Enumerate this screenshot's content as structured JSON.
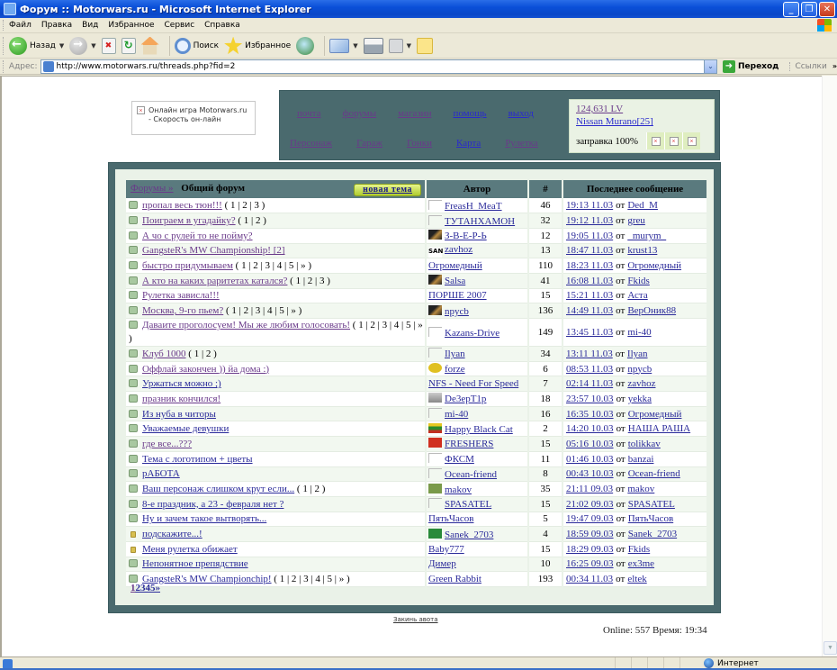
{
  "window": {
    "title": "Форум :: Motorwars.ru - Microsoft Internet Explorer",
    "min": "_",
    "max": "❐",
    "close": "✕"
  },
  "menu": [
    "Файл",
    "Правка",
    "Вид",
    "Избранное",
    "Сервис",
    "Справка"
  ],
  "toolbar": {
    "back": "Назад",
    "search": "Поиск",
    "favorites": "Избранное",
    "dropdown": "▼"
  },
  "address": {
    "label": "Адрес:",
    "url": "http://www.motorwars.ru/threads.php?fid=2",
    "go": "Переход",
    "links": "Ссылки",
    "more": "»",
    "dropdown": "⌄"
  },
  "banner": {
    "broken": "×",
    "text": "Онлайн игра Motorwars.ru - Скорость он-лайн"
  },
  "nav": {
    "row1": [
      {
        "label": "почта",
        "visited": true
      },
      {
        "label": "форумы",
        "visited": true
      },
      {
        "label": "магазин",
        "visited": true
      },
      {
        "label": "помощь",
        "visited": false
      },
      {
        "label": "выход",
        "visited": false
      }
    ],
    "row2": [
      {
        "label": "Персонаж",
        "visited": true
      },
      {
        "label": "Гараж",
        "visited": true
      },
      {
        "label": "Гонки",
        "visited": true
      },
      {
        "label": "Карта",
        "visited": false
      },
      {
        "label": "Рулетка",
        "visited": true
      }
    ]
  },
  "status": {
    "money": "124,631 LV",
    "car": "Nissan Murano[25]",
    "fuel": "заправка 100%",
    "broken": "×"
  },
  "forum": {
    "breadcrumb": "Форумы »",
    "title": "Общий форум",
    "new_topic": "новая тема",
    "columns": {
      "author": "Автор",
      "count": "#",
      "last": "Последнее сообщение"
    },
    "from_word": "от",
    "threads": [
      {
        "title": "пропал весь тюн!!!",
        "visited": true,
        "pages": "( 1 | 2 | 3 )",
        "author": "FreasH_MeaT",
        "avatar": "blank",
        "count": "46",
        "last_time": "19:13 11.03",
        "last_user": "Ded_M"
      },
      {
        "title": "Поиграем в угадайку?",
        "visited": true,
        "pages": "( 1 | 2 )",
        "author": "ТУТАНХАМОН",
        "avatar": "blank",
        "count": "32",
        "last_time": "19:12 11.03",
        "last_user": "greu"
      },
      {
        "title": "А чо с рулей то не пойму?",
        "visited": true,
        "pages": "",
        "author": "З-В-Е-Р-Ь",
        "avatar": "dark",
        "count": "12",
        "last_time": "19:05 11.03",
        "last_user": "_murym_"
      },
      {
        "title": "GangsteR's MW Championship! [2]",
        "visited": true,
        "pages": "",
        "author": "zavhoz",
        "avatar": "san",
        "count": "13",
        "last_time": "18:47 11.03",
        "last_user": "krust13"
      },
      {
        "title": "быстро придумываем",
        "visited": true,
        "pages": "( 1 | 2 | 3 | 4 | 5 | » )",
        "author": "Огромедный",
        "avatar": "none",
        "count": "110",
        "last_time": "18:23 11.03",
        "last_user": "Огромедный"
      },
      {
        "title": "А кто на каких раритетах катался?",
        "visited": true,
        "pages": "( 1 | 2 | 3 )",
        "author": "Salsa",
        "avatar": "dark",
        "count": "41",
        "last_time": "16:08 11.03",
        "last_user": "Fkids"
      },
      {
        "title": "Рулетка зависла!!!",
        "visited": true,
        "pages": "",
        "author": "ПОРШЕ 2007",
        "avatar": "none",
        "count": "15",
        "last_time": "15:21 11.03",
        "last_user": "Аста"
      },
      {
        "title": "Москва, 9-го пьем?",
        "visited": true,
        "pages": "( 1 | 2 | 3 | 4 | 5 | » )",
        "author": "npycb",
        "avatar": "dark",
        "count": "136",
        "last_time": "14:49 11.03",
        "last_user": "ВерОник88"
      },
      {
        "title": "Даваите проголосуем! Мы же любим голосовать!",
        "visited": true,
        "pages": "( 1 | 2 | 3 | 4 | 5 | » )",
        "author": "Kazans-Drive",
        "avatar": "blank",
        "count": "149",
        "last_time": "13:45 11.03",
        "last_user": "mi-40",
        "wrap": true
      },
      {
        "title": "Клуб 1000",
        "visited": true,
        "pages": "( 1 | 2 )",
        "author": "Ilyan",
        "avatar": "blank",
        "count": "34",
        "last_time": "13:11 11.03",
        "last_user": "Ilyan"
      },
      {
        "title": "Оффлай закончен )) йа дома :)",
        "visited": true,
        "pages": "",
        "author": "forze",
        "avatar": "yellow",
        "count": "6",
        "last_time": "08:53 11.03",
        "last_user": "npycb"
      },
      {
        "title": "Уржаться можно ;)",
        "visited": false,
        "pages": "",
        "author": "NFS - Need For Speed",
        "avatar": "none",
        "count": "7",
        "last_time": "02:14 11.03",
        "last_user": "zavhoz"
      },
      {
        "title": "празник кончился!",
        "visited": true,
        "pages": "",
        "author": "De3epT1p",
        "avatar": "tank",
        "count": "18",
        "last_time": "23:57 10.03",
        "last_user": "yekka"
      },
      {
        "title": "Из нуба в читоры",
        "visited": false,
        "pages": "",
        "author": "mi-40",
        "avatar": "blank",
        "count": "16",
        "last_time": "16:35 10.03",
        "last_user": "Огромедный"
      },
      {
        "title": "Уважаемые девушки",
        "visited": false,
        "pages": "",
        "author": "Happy Black Cat",
        "avatar": "flag",
        "count": "2",
        "last_time": "14:20 10.03",
        "last_user": "НАША РАША"
      },
      {
        "title": "где все...???",
        "visited": true,
        "pages": "",
        "author": "FRESHERS",
        "avatar": "ua",
        "count": "15",
        "last_time": "05:16 10.03",
        "last_user": "tolikkav"
      },
      {
        "title": "Тема с логотипом + цветы",
        "visited": false,
        "pages": "",
        "author": "ФКСМ",
        "avatar": "blank",
        "count": "11",
        "last_time": "01:46 10.03",
        "last_user": "banzai"
      },
      {
        "title": "рАБОТА",
        "visited": false,
        "pages": "",
        "author": "Ocean-friend",
        "avatar": "blank",
        "count": "8",
        "last_time": "00:43 10.03",
        "last_user": "Ocean-friend"
      },
      {
        "title": "Ваш персонаж слишком крут если...",
        "visited": false,
        "pages": "( 1 | 2 )",
        "author": "makov",
        "avatar": "money",
        "count": "35",
        "last_time": "21:11 09.03",
        "last_user": "makov"
      },
      {
        "title": "8-е праздник, а 23 - февраля нет ?",
        "visited": false,
        "pages": "",
        "author": "SPASATEL",
        "avatar": "blank",
        "count": "15",
        "last_time": "21:02 09.03",
        "last_user": "SPASATEL"
      },
      {
        "title": "Ну и зачем такое вытворять...",
        "visited": false,
        "pages": "",
        "author": "ПятьЧасов",
        "avatar": "none",
        "count": "5",
        "last_time": "19:47 09.03",
        "last_user": "ПятьЧасов"
      },
      {
        "title": "подскажите...!",
        "visited": false,
        "locked": true,
        "pages": "",
        "author": "Sanek_2703",
        "avatar": "sanek",
        "count": "4",
        "last_time": "18:59 09.03",
        "last_user": "Sanek_2703"
      },
      {
        "title": "Меня рулетка обижает",
        "visited": false,
        "locked": true,
        "pages": "",
        "author": "Baby777",
        "avatar": "none",
        "count": "15",
        "last_time": "18:29 09.03",
        "last_user": "Fkids"
      },
      {
        "title": "Непонятное препядствие",
        "visited": false,
        "pages": "",
        "author": "Димер",
        "avatar": "none",
        "count": "10",
        "last_time": "16:25 09.03",
        "last_user": "ex3me"
      },
      {
        "title": "GangsteR's MW Championchip!",
        "visited": false,
        "pages": "( 1 | 2 | 3 | 4 | 5 | » )",
        "author": "Green Rabbit",
        "avatar": "none",
        "count": "193",
        "last_time": "00:34 11.03",
        "last_user": "eltek"
      }
    ],
    "pager": [
      "1",
      "2",
      "3",
      "4",
      "5",
      "»"
    ],
    "current_page": "1"
  },
  "footer": {
    "bookmark": "Закинь авота",
    "online": "Online: 557  Время: 19:34"
  },
  "statusbar": {
    "zone": "Интернет"
  }
}
